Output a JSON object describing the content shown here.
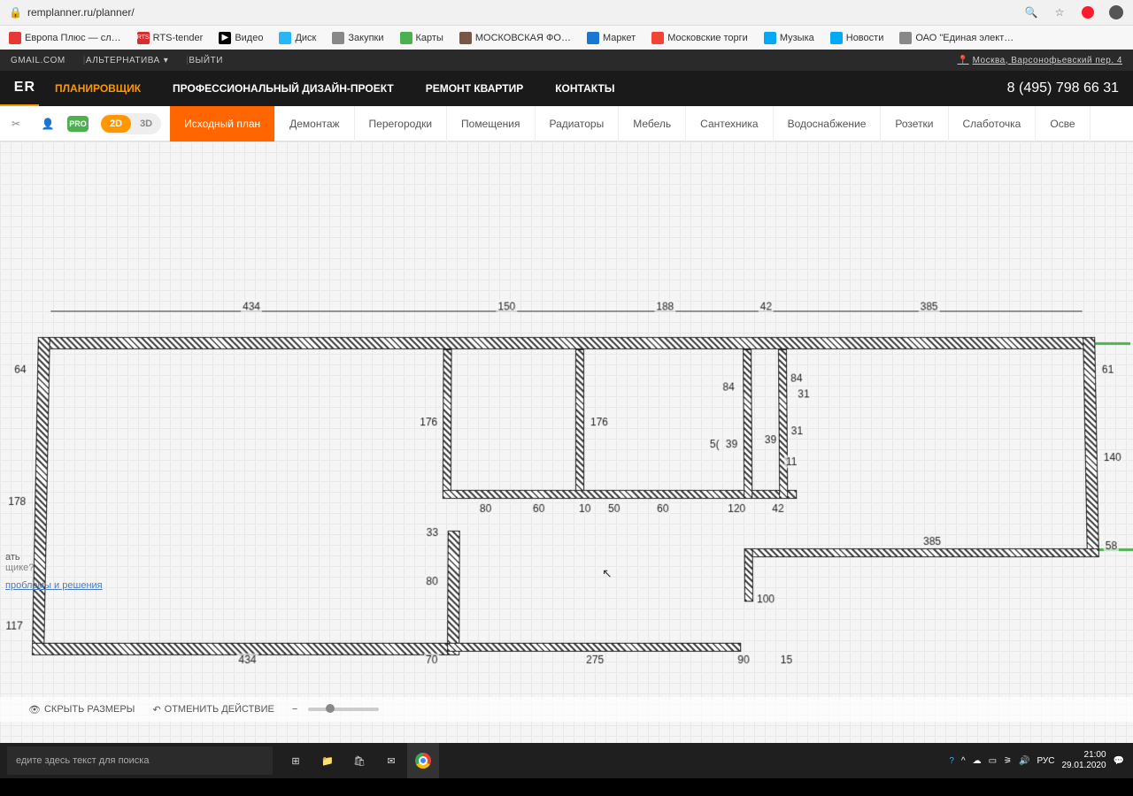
{
  "browser": {
    "url": "remplanner.ru/planner/",
    "icons": [
      "search",
      "star",
      "opera",
      "avatar"
    ]
  },
  "bookmarks": [
    {
      "label": "Европа Плюс — сл…",
      "color": "#e53935"
    },
    {
      "label": "RTS-tender",
      "color": "#d32f2f"
    },
    {
      "label": "Видео",
      "color": "#000"
    },
    {
      "label": "Диск",
      "color": "#29b6f6"
    },
    {
      "label": "Закупки",
      "color": "#888"
    },
    {
      "label": "Карты",
      "color": "#4caf50"
    },
    {
      "label": "МОСКОВСКАЯ ФО…",
      "color": "#795548"
    },
    {
      "label": "Маркет",
      "color": "#1976d2"
    },
    {
      "label": "Московские торги",
      "color": "#f44336"
    },
    {
      "label": "Музыка",
      "color": "#03a9f4"
    },
    {
      "label": "Новости",
      "color": "#03a9f4"
    },
    {
      "label": "ОАО \"Единая элект…",
      "color": "#888"
    }
  ],
  "userbar": {
    "email": "GMAIL.COM",
    "alt": "АЛЬТЕРНАТИВА",
    "logout": "ВЫЙТИ",
    "location": "Москва, Варсонофьевский пер. 4"
  },
  "nav": {
    "logo": "ER",
    "items": [
      "ПЛАНИРОВЩИК",
      "ПРОФЕССИОНАЛЬНЫЙ ДИЗАЙН-ПРОЕКТ",
      "РЕМОНТ КВАРТИР",
      "КОНТАКТЫ"
    ],
    "phone": "8 (495) 798 66 31"
  },
  "toolbar": {
    "view2d": "2D",
    "view3d": "3D",
    "tabs": [
      "Исходный план",
      "Демонтаж",
      "Перегородки",
      "Помещения",
      "Радиаторы",
      "Мебель",
      "Сантехника",
      "Водоснабжение",
      "Розетки",
      "Слаботочка",
      "Осве"
    ]
  },
  "plan": {
    "dims_top": [
      "434",
      "150",
      "188",
      "42",
      "385"
    ],
    "dims_left": [
      "64",
      "178",
      "117"
    ],
    "dims_right": [
      "61",
      "140",
      "58"
    ],
    "dims_inner": [
      "176",
      "176",
      "84",
      "84",
      "31",
      "31",
      "39",
      "39",
      "5(",
      "11",
      "80",
      "60",
      "10",
      "50",
      "60",
      "120",
      "42",
      "33",
      "80",
      "70",
      "275",
      "90",
      "15",
      "100",
      "385",
      "434"
    ]
  },
  "footer": {
    "help1": "ать",
    "help2": "щике?",
    "link": "проблемы и решения",
    "hide_dims": "СКРЫТЬ РАЗМЕРЫ",
    "undo": "ОТМЕНИТЬ ДЕЙСТВИЕ"
  },
  "taskbar": {
    "search_placeholder": "едите здесь текст для поиска",
    "lang": "РУС",
    "time": "21:00",
    "date": "29.01.2020"
  }
}
